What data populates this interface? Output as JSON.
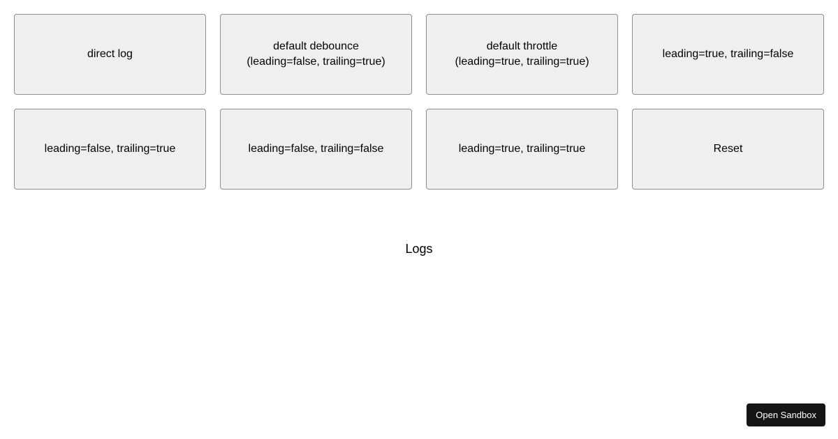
{
  "buttons": [
    {
      "id": "direct-log",
      "label": "direct log"
    },
    {
      "id": "default-debounce",
      "label": "default debounce\n(leading=false, trailing=true)"
    },
    {
      "id": "default-throttle",
      "label": "default throttle\n(leading=true, trailing=true)"
    },
    {
      "id": "leading-true-trailing-false",
      "label": "leading=true, trailing=false"
    },
    {
      "id": "leading-false-trailing-true",
      "label": "leading=false, trailing=true"
    },
    {
      "id": "leading-false-trailing-false",
      "label": "leading=false, trailing=false"
    },
    {
      "id": "leading-true-trailing-true",
      "label": "leading=true, trailing=true"
    },
    {
      "id": "reset",
      "label": "Reset"
    }
  ],
  "logs": {
    "heading": "Logs"
  },
  "sandbox": {
    "open_label": "Open Sandbox"
  }
}
